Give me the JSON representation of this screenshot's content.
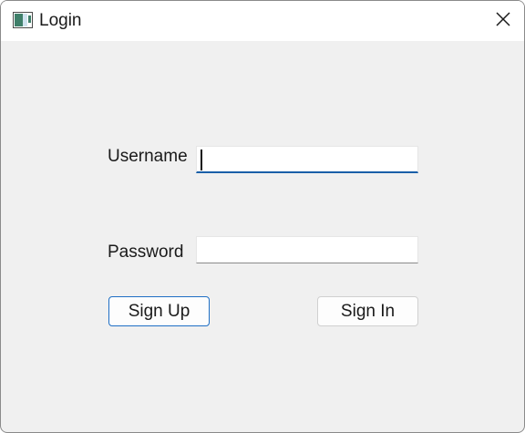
{
  "window": {
    "title": "Login"
  },
  "form": {
    "username_label": "Username",
    "username_value": "",
    "password_label": "Password",
    "password_value": ""
  },
  "buttons": {
    "signup_label": "Sign Up",
    "signin_label": "Sign In"
  },
  "icons": {
    "app": "app-window-icon",
    "close": "close-icon"
  },
  "colors": {
    "focus_accent": "#1a5fa8",
    "default_button_border": "#1f6fc5",
    "window_background": "#f0f0f0"
  }
}
